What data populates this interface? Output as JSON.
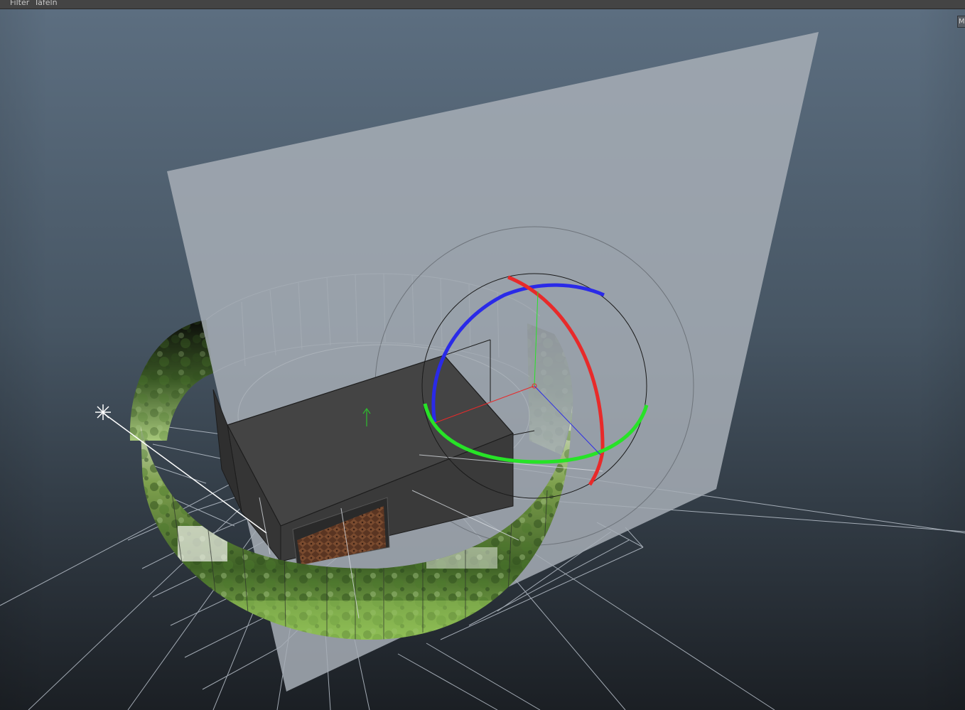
{
  "menubar": {
    "items": [
      {
        "label": "Filter"
      },
      {
        "label": "Tafeln"
      }
    ]
  },
  "panel_button": {
    "label": "M"
  },
  "colors": {
    "viewport_top": "#5c6e80",
    "viewport_bottom": "#1b1f24",
    "menubar_bg": "#444444",
    "grid": "#b9c1cb",
    "image_plane": "#a7aeb6",
    "cube": "#434343",
    "gizmo_x": "#e82a2a",
    "gizmo_y": "#27e327",
    "gizmo_z": "#2a2ae8",
    "panorama_foliage": "#6f9442"
  },
  "icons": [
    "light-icon",
    "up-arrow-icon"
  ]
}
